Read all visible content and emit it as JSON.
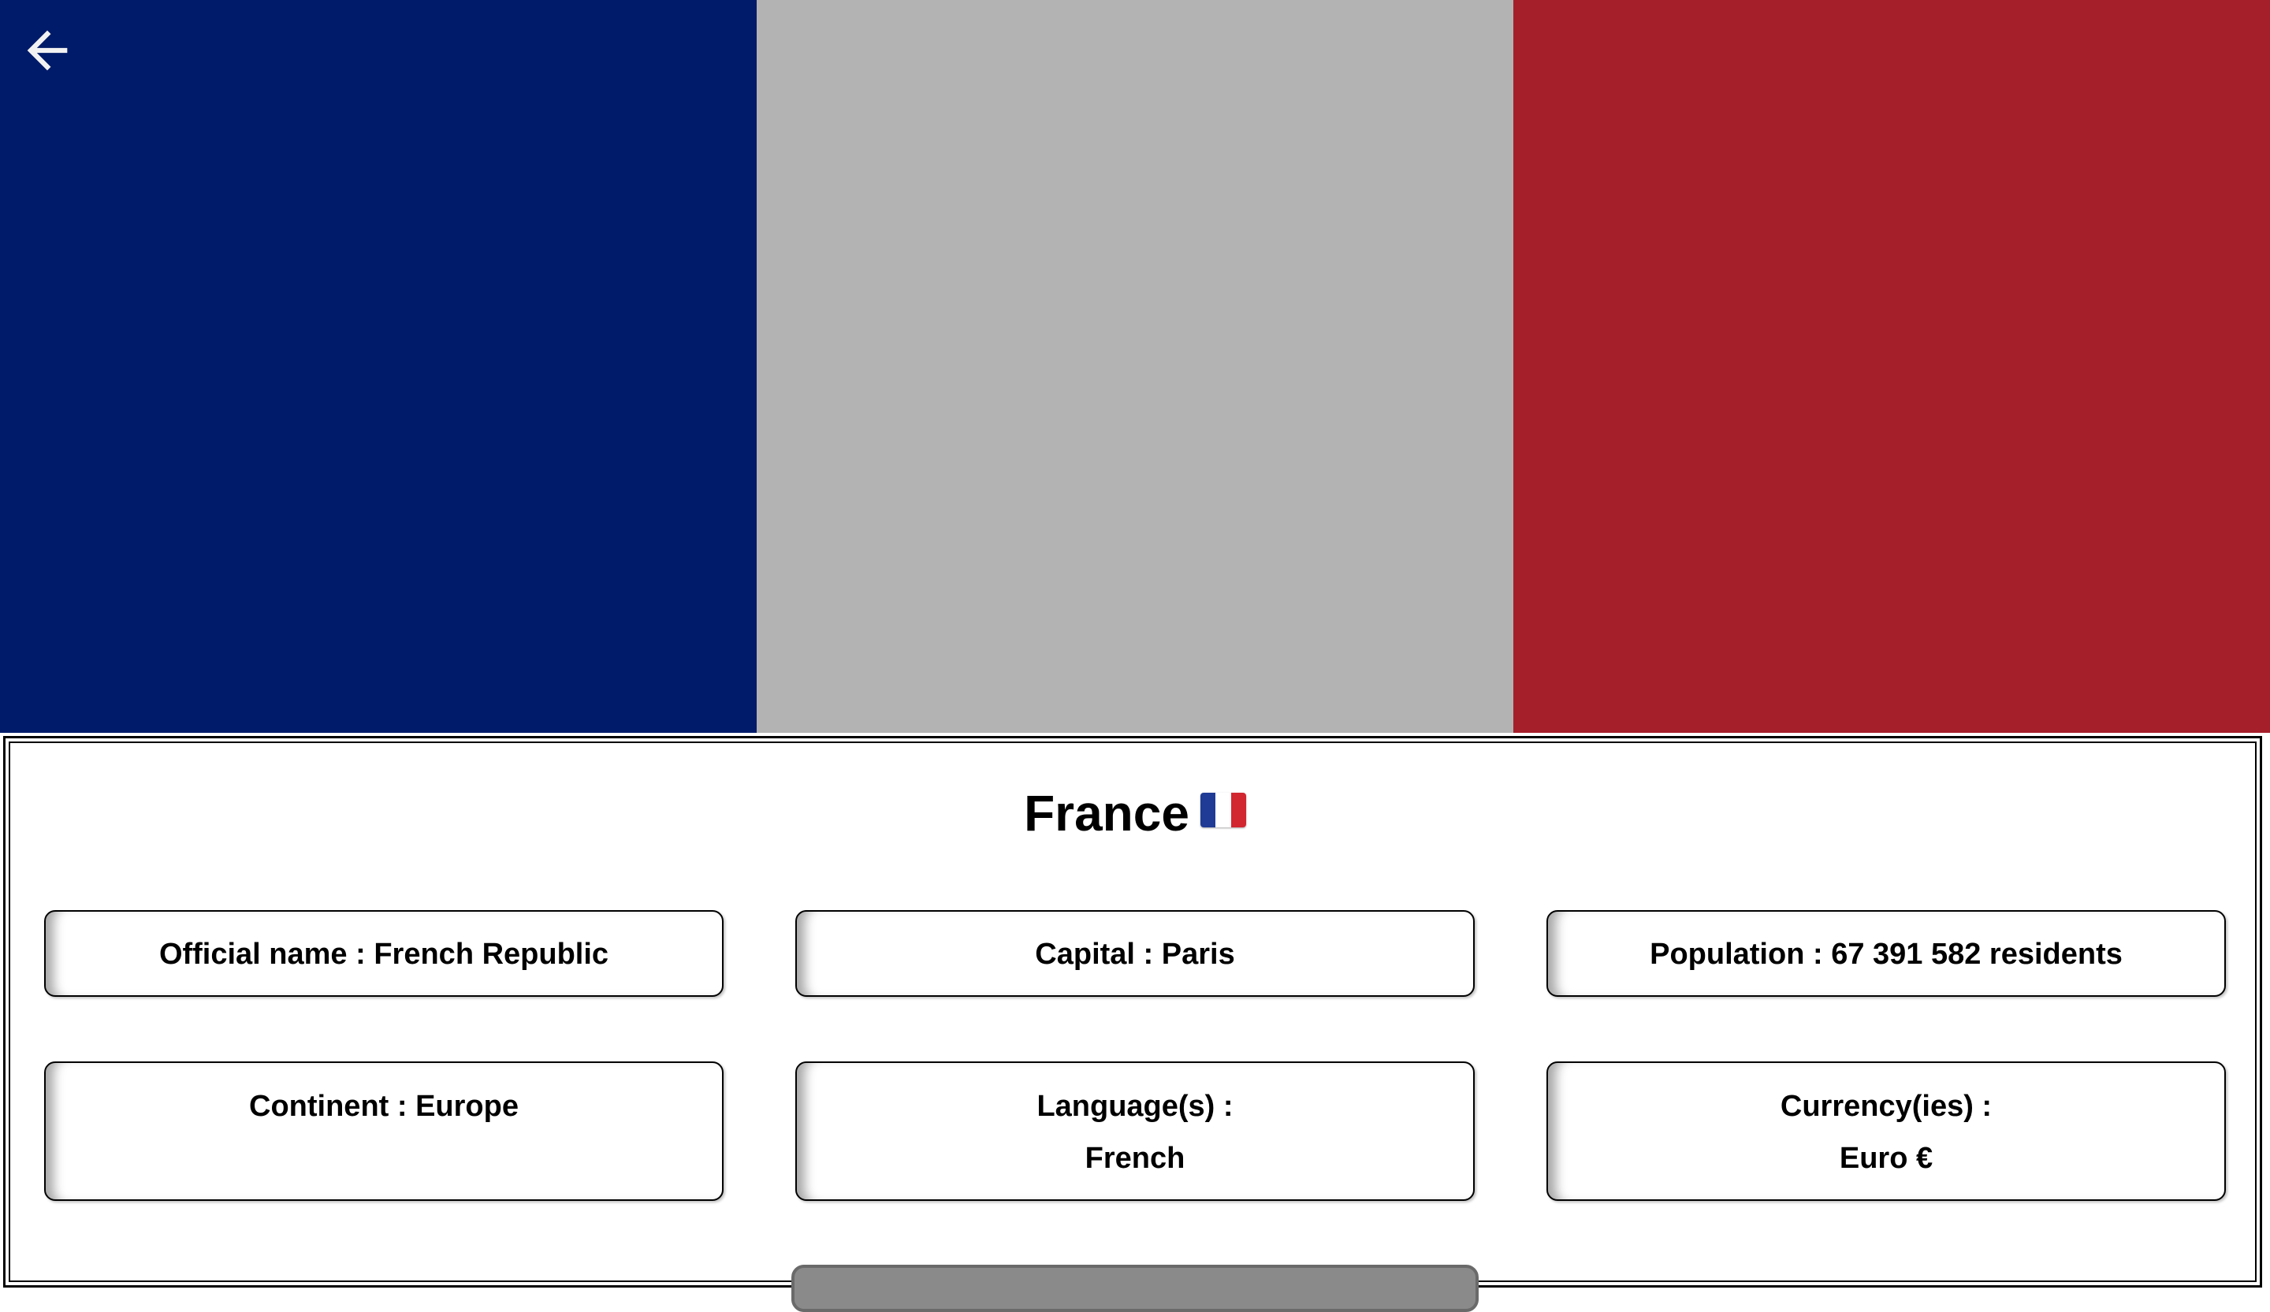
{
  "flag": {
    "colors": [
      "#001B69",
      "#B3B3B3",
      "#A51F2B"
    ]
  },
  "nav": {
    "back_icon": "arrow-left-icon",
    "back_icon_color": "#F2F2F2"
  },
  "country": {
    "name": "France",
    "flag_icon": "france-flag-icon",
    "flag_emoji_colors": [
      "#1F3B95",
      "#FFFFFF",
      "#D22630"
    ]
  },
  "cards": {
    "official_name": "Official name : French Republic",
    "capital": "Capital : Paris",
    "population": "Population : 67 391 582 residents",
    "continent": "Continent : Europe",
    "languages_label": "Language(s) :",
    "languages_value": "French",
    "currencies_label": "Currency(ies) :",
    "currencies_value": "Euro €"
  },
  "more_button": {
    "color": "#8A8A8A"
  }
}
